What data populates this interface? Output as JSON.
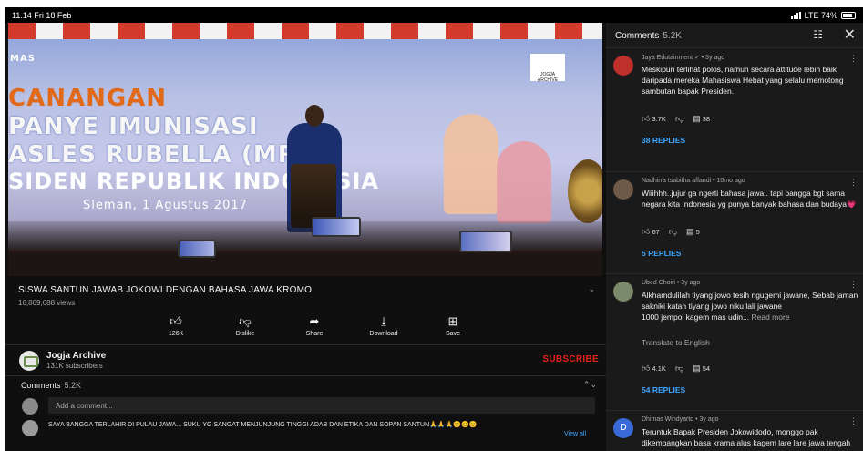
{
  "status_bar": {
    "time": "11.14 Fri 18 Feb",
    "network": "LTE 74%"
  },
  "video": {
    "overlay_texts": [
      "CANANGAN",
      "PANYE IMUNISASI",
      "ASLES RUBELLA (MR",
      "SIDEN REPUBLIK INDONESIA",
      "Sleman, 1 Agustus 2017",
      "MAS"
    ],
    "logo_text": "JOGJA ARCHIVE",
    "title": "SISWA SANTUN JAWAB JOKOWI DENGAN BAHASA JAWA KROMO",
    "views": "16,869,688 views"
  },
  "actions": [
    {
      "icon": "thumbs-up-icon",
      "label": "126K"
    },
    {
      "icon": "thumbs-down-icon",
      "label": "Dislike"
    },
    {
      "icon": "share-icon",
      "label": "Share"
    },
    {
      "icon": "download-icon",
      "label": "Download"
    },
    {
      "icon": "save-icon",
      "label": "Save"
    }
  ],
  "channel": {
    "name": "Jogja Archive",
    "subscribers": "131K subscribers",
    "subscribe_label": "SUBSCRIBE"
  },
  "comments_mini": {
    "title": "Comments",
    "count": "5.2K",
    "add_placeholder": "Add a comment...",
    "top_comment": "SAYA BANGGA TERLAHIR DI PULAU JAWA... SUKU YG SANGAT MENJUNJUNG TINGGI ADAB DAN ETIKA DAN SOPAN SANTUN🙏🙏🙏😊😊😊",
    "view_all": "View all"
  },
  "panel": {
    "title": "Comments",
    "count": "5.2K",
    "comments": [
      {
        "meta": "Jaya Edutainment ✓ • 3y ago",
        "text": "Meskipun terlihat polos, namun secara attitude lebih baik daripada mereka Mahasiswa Hebat yang selalu memotong sambutan bapak Presiden.",
        "likes": "3.7K",
        "replies_count": "38",
        "replies_label": "38 REPLIES",
        "avatar_color": "#c0302a"
      },
      {
        "meta": "Nadhirra tsabitha affandi • 10mo ago",
        "text": "Wiiihhh..jujur ga ngerti bahasa jawa.. tapi bangga bgt sama negara kita Indonesia yg punya banyak bahasa dan budaya💗",
        "likes": "67",
        "replies_count": "5",
        "replies_label": "5 REPLIES",
        "avatar_color": "#6e5a48"
      },
      {
        "meta": "Ubed Choiri • 3y ago",
        "text": "Alkhamdulilah tiyang jowo tesih ngugemi jawane, Sebab jaman sakniki katah tiyang jowo niku lali jawane",
        "text_extra": "1000 jempol kagem mas udin...",
        "read_more": "Read more",
        "translate": "Translate to English",
        "likes": "4.1K",
        "replies_count": "54",
        "replies_label": "54 REPLIES",
        "avatar_color": "#7a8a6a"
      },
      {
        "meta": "Dhimas Windyarto • 3y ago",
        "text": "Teruntuk Bapak Presiden Jokowidodo, monggo pak dikembangkan basa krama alus kagem lare lare jawa tengah lan jawa timur. Kathah lare",
        "avatar_letter": "D",
        "avatar_color": "#3a6ad8"
      }
    ]
  }
}
